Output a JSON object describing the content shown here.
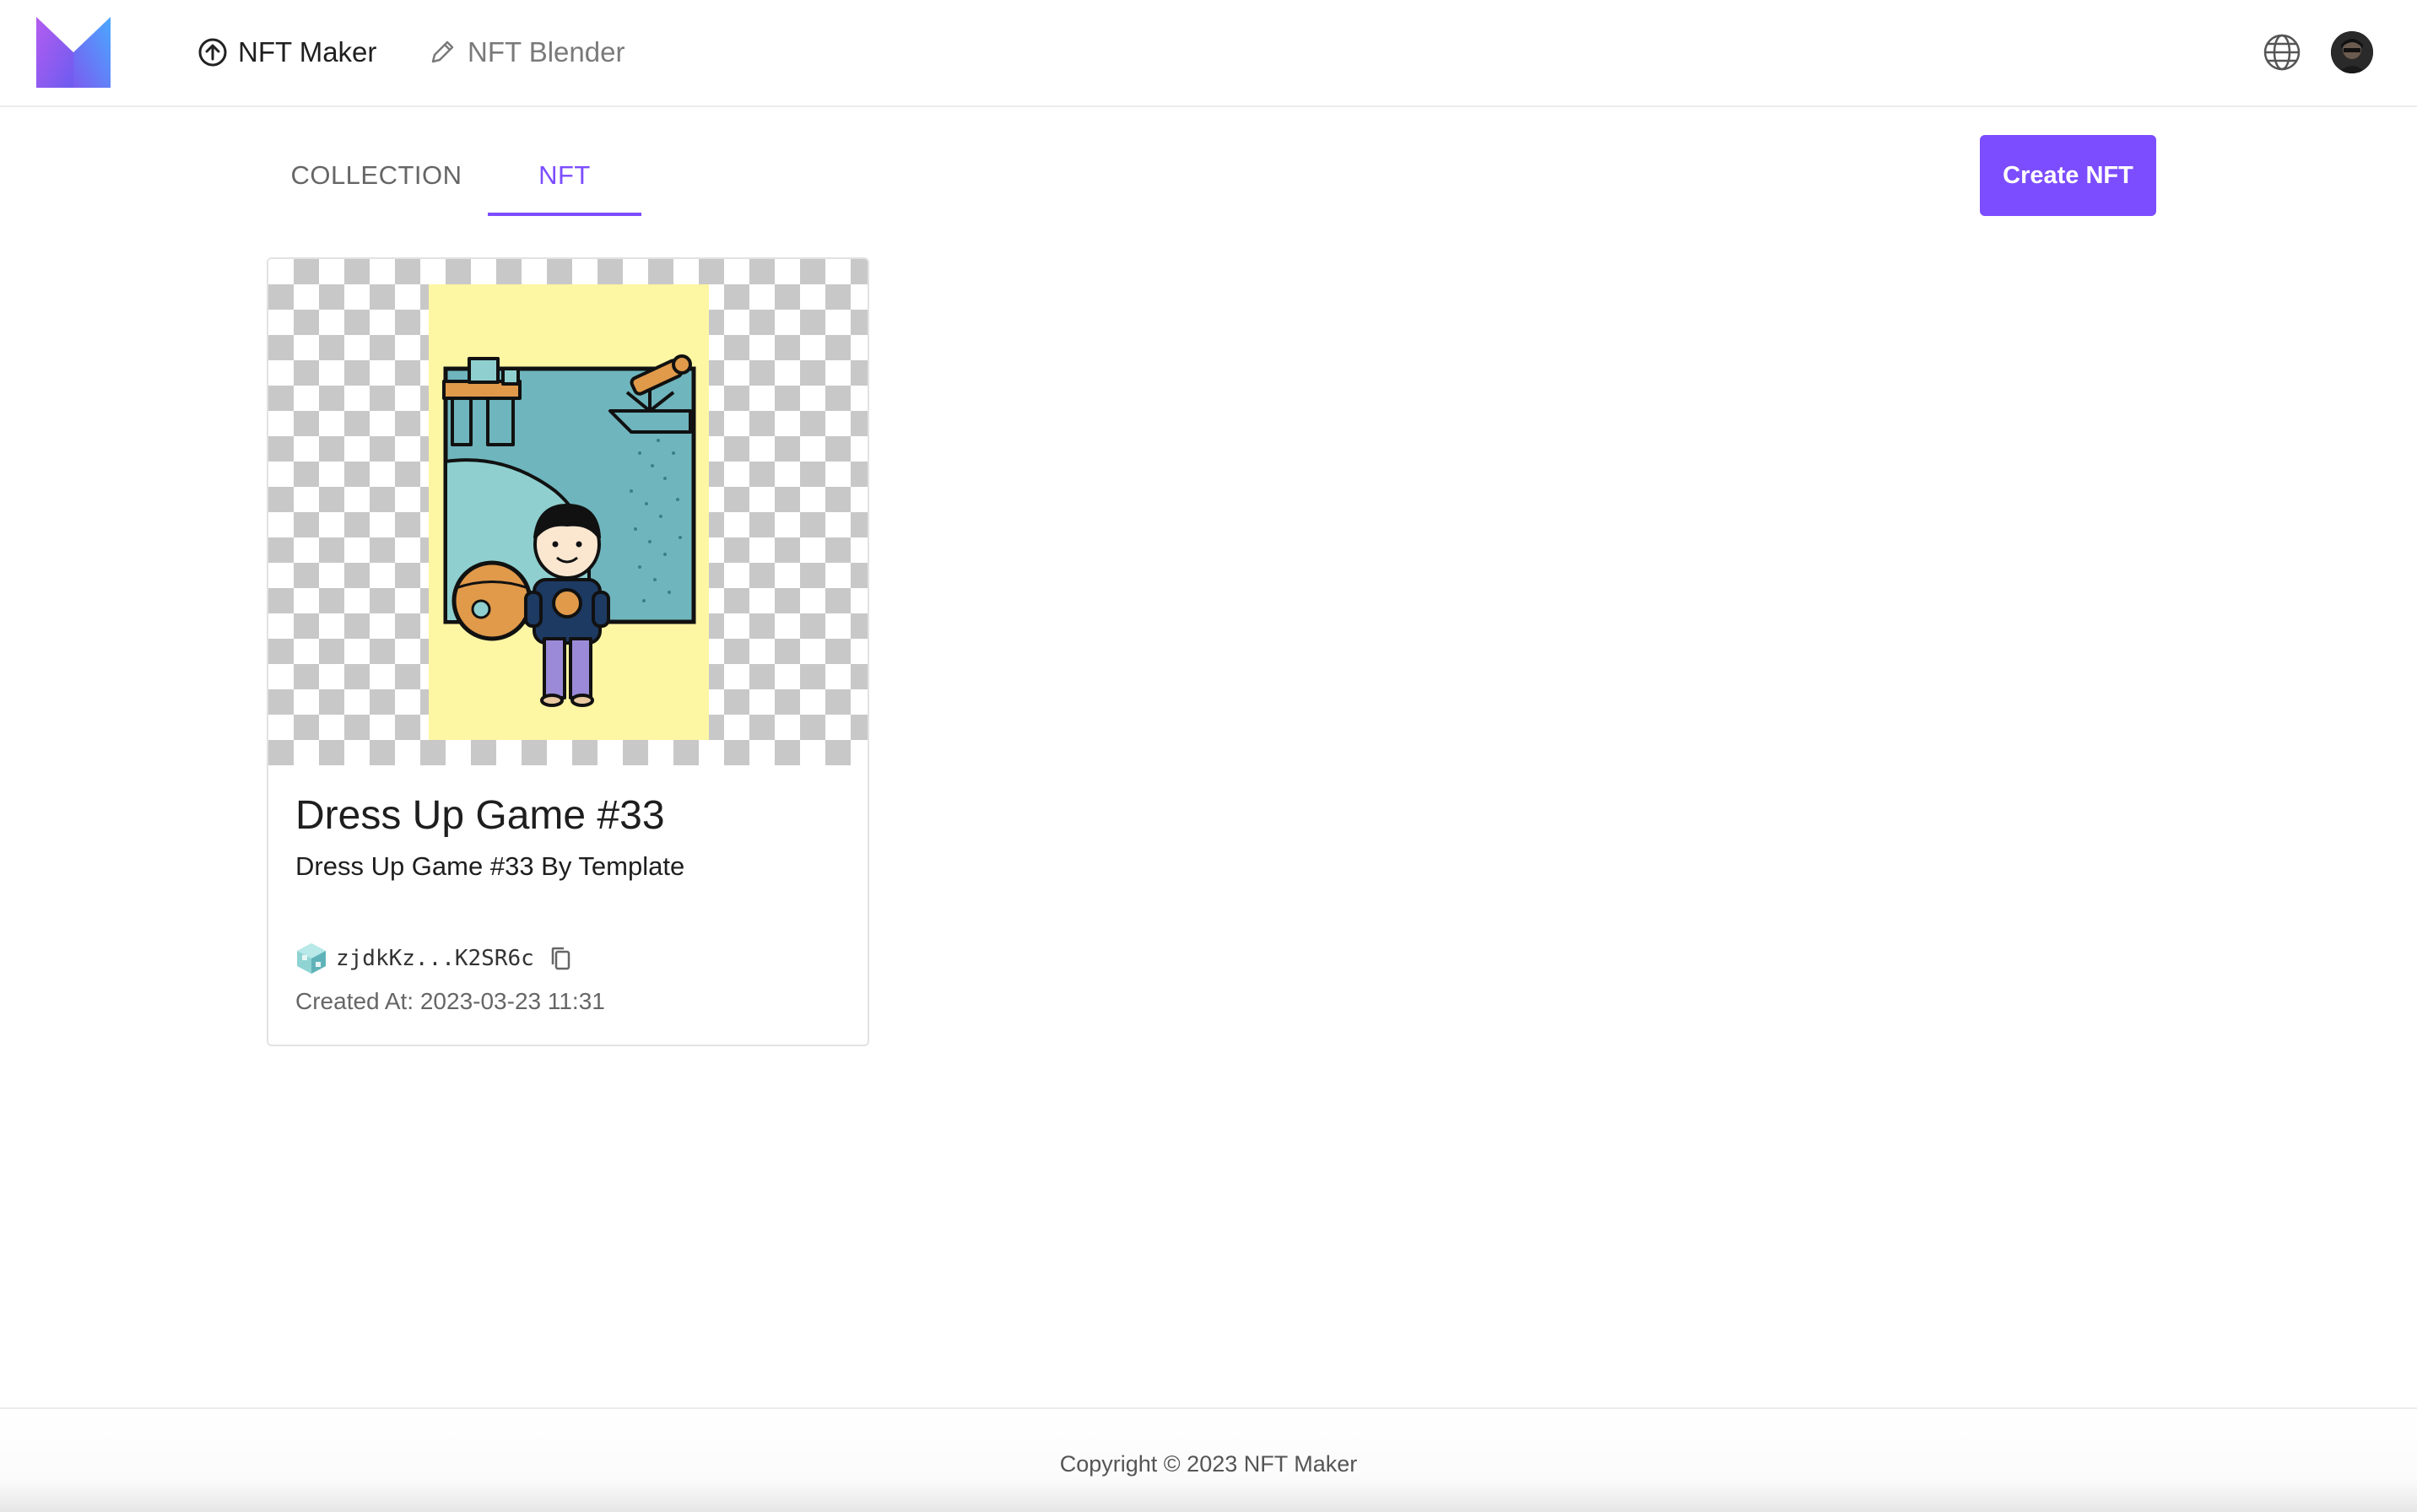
{
  "header": {
    "nav": [
      {
        "label": "NFT Maker",
        "icon": "upload-circle-icon"
      },
      {
        "label": "NFT Blender",
        "icon": "pencil-icon"
      }
    ],
    "language_icon": "globe-icon",
    "avatar_icon": "user-avatar"
  },
  "tabs": [
    {
      "label": "COLLECTION",
      "active": false
    },
    {
      "label": "NFT",
      "active": true
    }
  ],
  "actions": {
    "create_label": "Create NFT"
  },
  "cards": [
    {
      "title": "Dress Up Game #33",
      "subtitle": "Dress Up Game #33 By Template",
      "owner_address": "zjdkKz...K2SR6c",
      "created": "Created At: 2023-03-23 11:31"
    }
  ],
  "footer": {
    "copyright": "Copyright © 2023 NFT Maker"
  },
  "colors": {
    "accent": "#7c4dff",
    "art_background": "#fdf6a3",
    "art_panel": "#6fb5bd"
  }
}
